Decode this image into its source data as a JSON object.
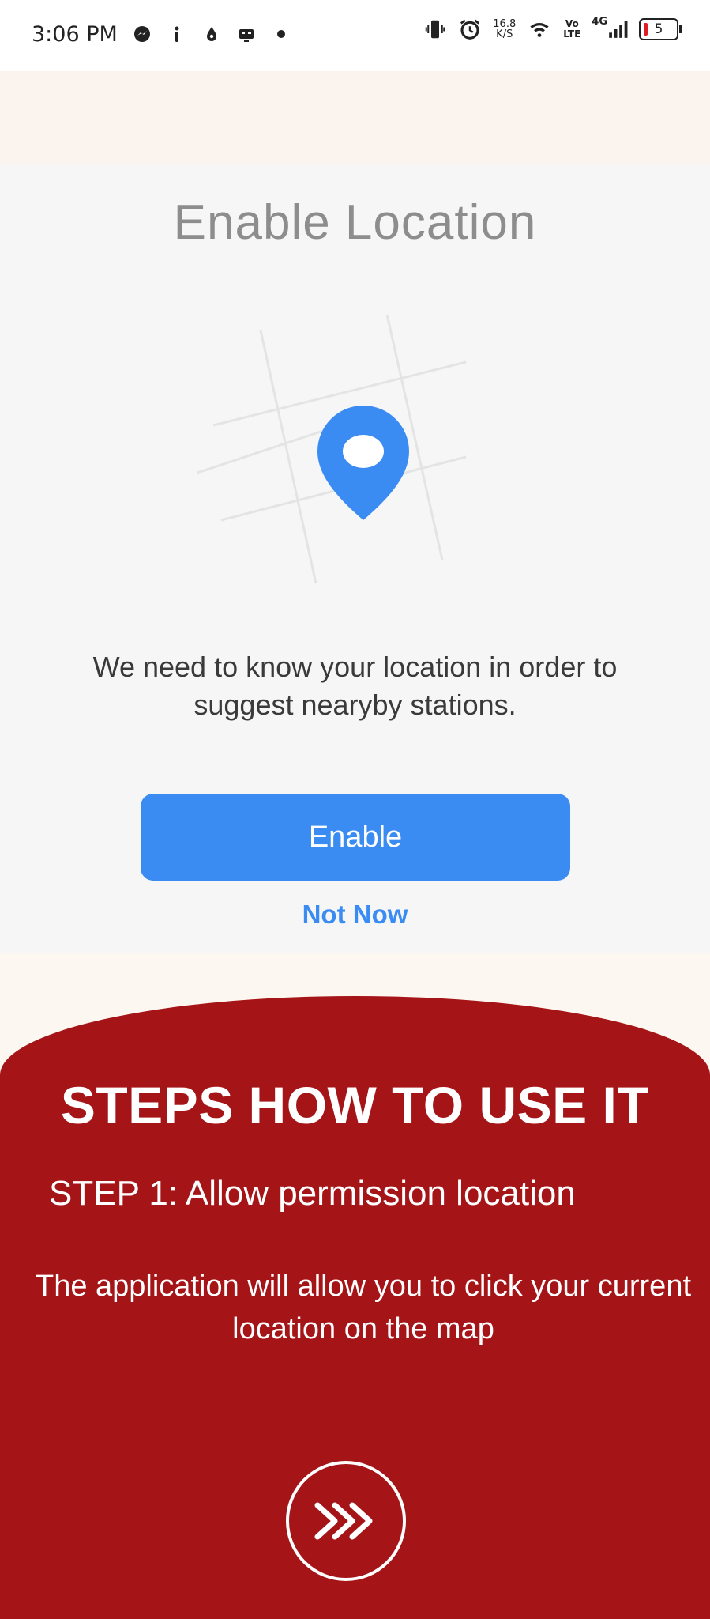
{
  "status_bar": {
    "time": "3:06 PM",
    "left_icons": [
      "messenger-icon",
      "info-icon",
      "drop-icon",
      "robot-icon",
      "dot-icon"
    ],
    "net_speed_top": "16.8",
    "net_speed_bottom": "K/S",
    "vo_top": "Vo",
    "vo_bottom": "LTE",
    "network_type": "4G",
    "battery_level": "5",
    "right_icons": [
      "vibrate-icon",
      "alarm-icon",
      "wifi-icon",
      "signal-icon",
      "battery-icon"
    ]
  },
  "card": {
    "title": "Enable Location",
    "description": "We need to know your location in order to suggest nearyby stations.",
    "enable_label": "Enable",
    "not_now_label": "Not Now",
    "accent_color": "#3a8cf3"
  },
  "steps": {
    "heading": "STEPS HOW TO USE IT",
    "step_label": "STEP 1:  Allow permission location",
    "step_description": "The application will allow you to click your current location on the map",
    "panel_color": "#a51417"
  }
}
